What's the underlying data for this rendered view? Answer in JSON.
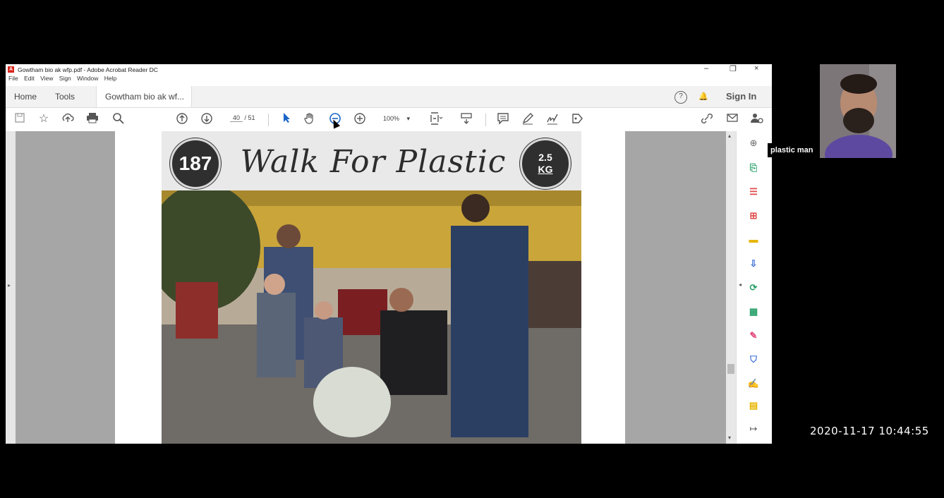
{
  "window": {
    "title": "Gowtham bio ak wfp.pdf - Adobe Acrobat Reader DC",
    "controls": {
      "minimize": "–",
      "restore": "❐",
      "close": "×"
    }
  },
  "menu": [
    "File",
    "Edit",
    "View",
    "Sign",
    "Window",
    "Help"
  ],
  "tabs": {
    "home": "Home",
    "tools": "Tools",
    "document": "Gowtham bio ak wf...",
    "close": "×",
    "help": "?",
    "bell": "🔔",
    "sign_in": "Sign In"
  },
  "toolbar": {
    "current_page": "40",
    "page_separator": "/",
    "total_pages": "51",
    "zoom": "100%",
    "zoom_caret": "▾"
  },
  "document": {
    "badge_left": "187",
    "title": "Walk For Plastic",
    "badge_right_value": "2.5",
    "badge_right_unit": "KG"
  },
  "video": {
    "participant_name": "plastic man"
  },
  "timestamp": "2020-11-17 10:44:55",
  "icons": {
    "save": "save-icon",
    "bookmark": "star-icon",
    "upload": "cloud-upload-icon",
    "print": "print-icon",
    "search": "search-icon",
    "page_up": "arrow-up-circle-icon",
    "page_down": "arrow-down-circle-icon",
    "select": "cursor-icon",
    "hand": "hand-icon",
    "zoom_out": "zoom-out-icon",
    "zoom_in": "zoom-in-icon"
  },
  "colors": {
    "acrobat_red": "#d9261c",
    "panel_background": "#a6a6a6"
  }
}
